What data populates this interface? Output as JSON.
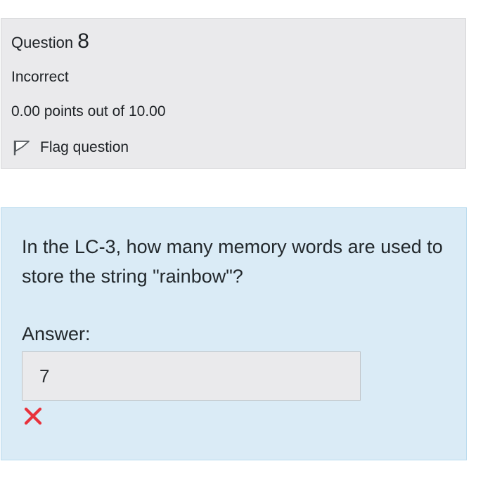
{
  "question_info": {
    "label": "Question",
    "number": "8",
    "state": "Incorrect",
    "grade": "0.00 points out of 10.00",
    "flag_label": "Flag question",
    "flag_icon": "flag-icon"
  },
  "question": {
    "text": "In the LC-3, how many memory words are used to store the string \"rainbow\"?",
    "answer_label": "Answer:",
    "answer_value": "7",
    "feedback_icon": "incorrect-x-icon"
  },
  "colors": {
    "info_bg": "#eaeaec",
    "content_bg": "#daebf6",
    "incorrect": "#e8323c"
  }
}
